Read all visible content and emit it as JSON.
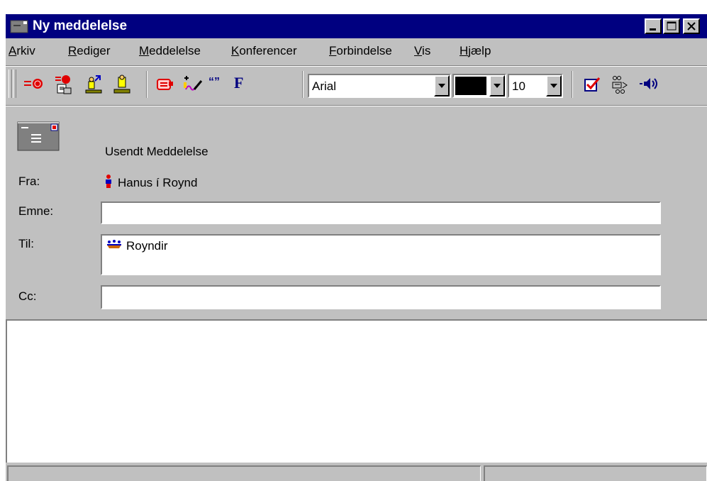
{
  "window": {
    "title": "Ny meddelelse",
    "colors": {
      "titlebar": "#000080",
      "face": "#c0c0c0"
    }
  },
  "menu": [
    {
      "first": "A",
      "rest": "rkiv"
    },
    {
      "first": "R",
      "rest": "ediger"
    },
    {
      "first": "M",
      "rest": "eddelelse"
    },
    {
      "first": "K",
      "rest": "onferencer"
    },
    {
      "first": "F",
      "rest": "orbindelse"
    },
    {
      "first": "V",
      "rest": "is"
    },
    {
      "first": "H",
      "rest": "jælp"
    }
  ],
  "toolbar": {
    "icons": [
      "send-icon",
      "send-later-icon",
      "address-book-icon",
      "check-names-icon",
      "attach-icon",
      "signature-icon",
      "quote-icon",
      "bold-icon",
      "spell-check-icon",
      "translate-icon",
      "speaker-icon"
    ],
    "quote_glyph": "“”",
    "bold_glyph": "F",
    "font_name": "Arial",
    "font_color": "#000000",
    "font_size": "10"
  },
  "header": {
    "status": "Usendt Meddelelse",
    "from_label": "Fra:",
    "from_value": "Hanus í Roynd",
    "subject_label": "Emne:",
    "subject_value": "",
    "to_label": "Til:",
    "to_recipient": "Royndir",
    "cc_label": "Cc:",
    "cc_value": ""
  },
  "body": {
    "text": ""
  }
}
